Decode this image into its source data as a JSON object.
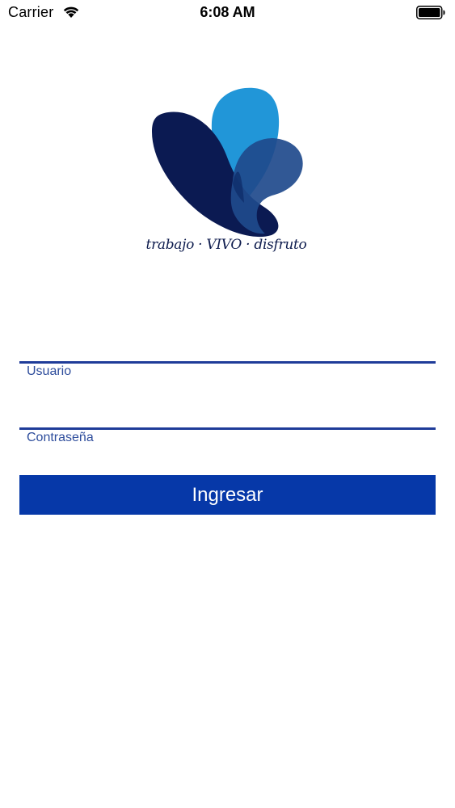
{
  "status_bar": {
    "carrier": "Carrier",
    "time": "6:08 AM",
    "icons": [
      "wifi-icon",
      "battery-icon"
    ]
  },
  "logo": {
    "tagline": "trabajo · VIVO · disfruto",
    "colors": {
      "dark_navy": "#0b1a52",
      "sky_blue": "#2196d8",
      "mid_blue": "#1d4a8a"
    }
  },
  "form": {
    "username_label": "Usuario",
    "password_label": "Contraseña",
    "username_value": "",
    "password_value": "",
    "submit_label": "Ingresar"
  },
  "colors": {
    "accent": "#0638a8",
    "field_line": "#1f3c99",
    "label": "#2e4d9c"
  }
}
